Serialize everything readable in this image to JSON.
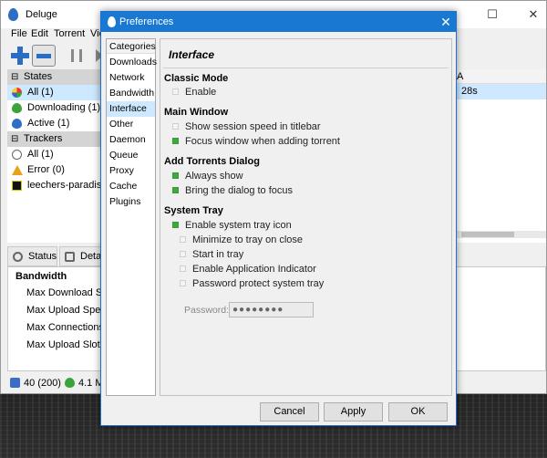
{
  "main_window": {
    "title": "Deluge",
    "menu": [
      "File",
      "Edit",
      "Torrent",
      "View"
    ],
    "sidebar": {
      "states_header": "States",
      "states": [
        {
          "label": "All (1)"
        },
        {
          "label": "Downloading (1)"
        },
        {
          "label": "Active (1)"
        }
      ],
      "trackers_header": "Trackers",
      "trackers": [
        {
          "label": "All (1)"
        },
        {
          "label": "Error (0)"
        },
        {
          "label": "leechers-paradise.org"
        }
      ]
    },
    "torrent_list": {
      "col_partial": "A",
      "eta": "28s"
    },
    "tabs": [
      "Status",
      "Details"
    ],
    "details": {
      "section": "Bandwidth",
      "labels": [
        "Max Download Speed:",
        "Max Upload Speed:",
        "Max Connections:",
        "Max Upload Slots:"
      ]
    },
    "statusbar": {
      "connections": "40 (200)",
      "download": "4.1 M"
    }
  },
  "dialog": {
    "title": "Preferences",
    "categories_header": "Categories",
    "categories": [
      "Downloads",
      "Network",
      "Bandwidth",
      "Interface",
      "Other",
      "Daemon",
      "Queue",
      "Proxy",
      "Cache",
      "Plugins"
    ],
    "selected_category": "Interface",
    "pane_title": "Interface",
    "groups": {
      "classic_mode": {
        "title": "Classic Mode",
        "items": [
          {
            "label": "Enable",
            "checked": false
          }
        ]
      },
      "main_window": {
        "title": "Main Window",
        "items": [
          {
            "label": "Show session speed in titlebar",
            "checked": false
          },
          {
            "label": "Focus window when adding torrent",
            "checked": true
          }
        ]
      },
      "add_torrents": {
        "title": "Add Torrents Dialog",
        "items": [
          {
            "label": "Always show",
            "checked": true
          },
          {
            "label": "Bring the dialog to focus",
            "checked": true
          }
        ]
      },
      "system_tray": {
        "title": "System Tray",
        "items": [
          {
            "label": "Enable system tray icon",
            "checked": true
          },
          {
            "label": "Minimize to tray on close",
            "checked": false
          },
          {
            "label": "Start in tray",
            "checked": false
          },
          {
            "label": "Enable Application Indicator",
            "checked": false
          },
          {
            "label": "Password protect system tray",
            "checked": false
          }
        ],
        "password_label": "Password:",
        "password_value": "●●●●●●●●"
      }
    },
    "buttons": {
      "cancel": "Cancel",
      "apply": "Apply",
      "ok": "OK"
    }
  },
  "colors": {
    "dialog_title_bar": "#1979d2",
    "selection": "#cde8ff",
    "checkbox_on": "#3cab3b"
  }
}
